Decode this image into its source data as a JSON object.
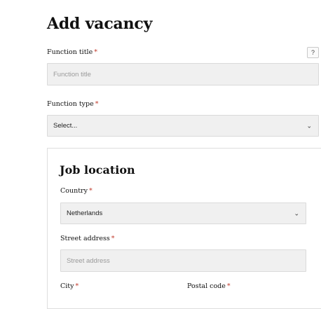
{
  "form": {
    "title": "Add vacancy",
    "required_marker": "*",
    "help_label": "?",
    "function_title": {
      "label": "Function title",
      "placeholder": "Function title"
    },
    "function_type": {
      "label": "Function type",
      "selected": "Select..."
    },
    "job_location": {
      "title": "Job location",
      "country": {
        "label": "Country",
        "selected": "Netherlands"
      },
      "street_address": {
        "label": "Street address",
        "placeholder": "Street address"
      },
      "city": {
        "label": "City"
      },
      "postal_code": {
        "label": "Postal code"
      }
    }
  },
  "icons": {
    "dropdown": "chevron-down-icon",
    "help": "question-mark-icon"
  },
  "colors": {
    "required": "#c0392b",
    "field_bg": "#f0f0f0",
    "field_border": "#dadada"
  }
}
